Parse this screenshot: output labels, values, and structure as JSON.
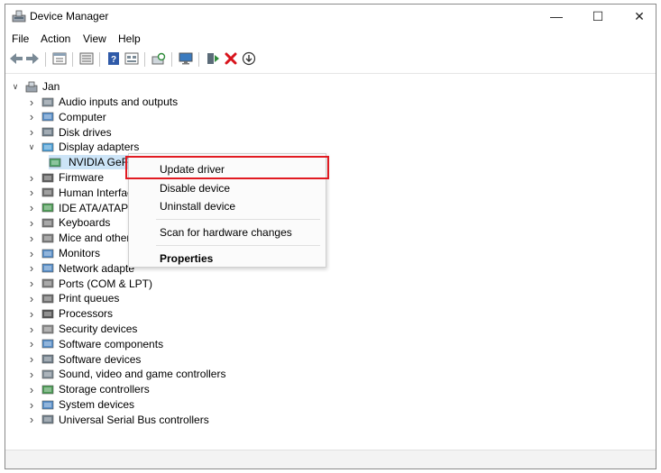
{
  "window": {
    "title": "Device Manager",
    "minimize_glyph": "—",
    "maximize_glyph": "☐",
    "close_glyph": "✕"
  },
  "menu": [
    "File",
    "Action",
    "View",
    "Help"
  ],
  "toolbar": {
    "icons": [
      "back-arrow-icon",
      "forward-arrow-icon",
      "properties-sheet-icon",
      "list-view-icon",
      "help-icon",
      "properties-icon",
      "scan-icon",
      "monitor-icon",
      "update-driver-icon",
      "uninstall-icon",
      "download-icon"
    ]
  },
  "tree": {
    "root": "Jan",
    "categories": [
      {
        "label": "Audio inputs and outputs",
        "expanded": false
      },
      {
        "label": "Computer",
        "expanded": false
      },
      {
        "label": "Disk drives",
        "expanded": false
      },
      {
        "label": "Display adapters",
        "expanded": true
      },
      {
        "label": "NVIDIA GeForce GTX 1650",
        "child": true
      },
      {
        "label": "Firmware",
        "expanded": false
      },
      {
        "label": "Human Interfac",
        "expanded": false
      },
      {
        "label": "IDE ATA/ATAPI c",
        "expanded": false
      },
      {
        "label": "Keyboards",
        "expanded": false
      },
      {
        "label": "Mice and other",
        "expanded": false
      },
      {
        "label": "Monitors",
        "expanded": false
      },
      {
        "label": "Network adapte",
        "expanded": false
      },
      {
        "label": "Ports (COM & LPT)",
        "expanded": false
      },
      {
        "label": "Print queues",
        "expanded": false
      },
      {
        "label": "Processors",
        "expanded": false
      },
      {
        "label": "Security devices",
        "expanded": false
      },
      {
        "label": "Software components",
        "expanded": false
      },
      {
        "label": "Software devices",
        "expanded": false
      },
      {
        "label": "Sound, video and game controllers",
        "expanded": false
      },
      {
        "label": "Storage controllers",
        "expanded": false
      },
      {
        "label": "System devices",
        "expanded": false
      },
      {
        "label": "Universal Serial Bus controllers",
        "expanded": false
      }
    ]
  },
  "context_menu": {
    "update_driver": "Update driver",
    "disable_device": "Disable device",
    "uninstall_device": "Uninstall device",
    "scan": "Scan for hardware changes",
    "properties": "Properties"
  },
  "colors": {
    "highlight_border": "#e11b22",
    "selection": "#cce4f7",
    "uninstall_red": "#d8141c",
    "update_green": "#2e8b3a"
  }
}
